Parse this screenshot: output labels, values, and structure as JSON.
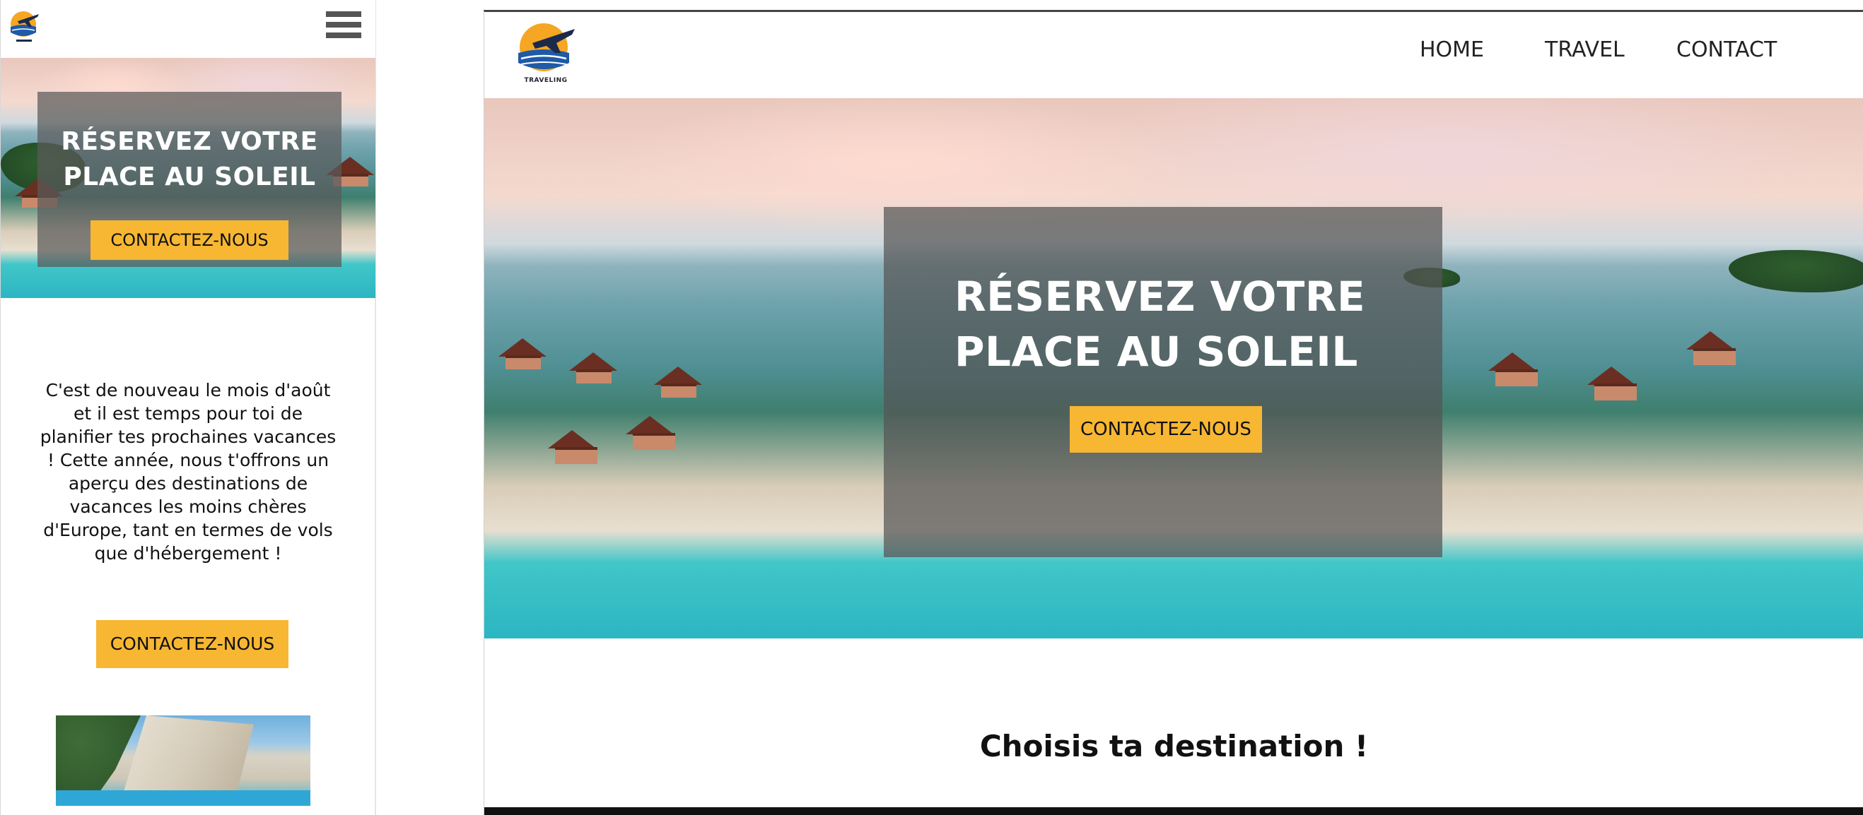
{
  "mobile": {
    "logo_icon": "travel-logo-icon",
    "menu_icon": "hamburger-menu-icon",
    "hero": {
      "title": "RÉSERVEZ VOTRE PLACE AU SOLEIL",
      "cta_label": "CONTACTEZ-NOUS"
    },
    "intro_text": "C'est de nouveau le mois d'août et il est temps pour toi de planifier tes prochaines vacances ! Cette année, nous t'offrons un aperçu des destinations de vacances les moins chères d'Europe, tant en termes de vols que d'hébergement !",
    "cta2_label": "CONTACTEZ-NOUS",
    "photo": "destination-photo"
  },
  "desktop": {
    "logo_icon": "travel-logo-icon",
    "logo_text": "TRAVELING",
    "nav": [
      {
        "label": "HOME"
      },
      {
        "label": "TRAVEL"
      },
      {
        "label": "CONTACT"
      }
    ],
    "hero": {
      "title": "RÉSERVEZ VOTRE PLACE AU SOLEIL",
      "cta_label": "CONTACTEZ-NOUS"
    },
    "section_title": "Choisis ta destination !"
  },
  "colors": {
    "accent": "#f7b733",
    "overlay": "#555555",
    "ocean": "#2cb6c2",
    "logo_sun": "#f5a623",
    "logo_blue": "#1e5aa8"
  }
}
